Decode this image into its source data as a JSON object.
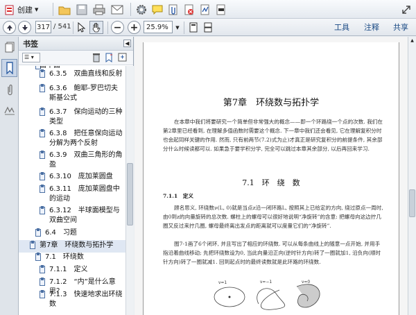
{
  "toolbar": {
    "create_label": "创建",
    "page_current": "317",
    "page_total": "/ 541",
    "zoom": "25.9%",
    "tab_tools": "工具",
    "tab_comment": "注释",
    "tab_share": "共享"
  },
  "bookmarks": {
    "title": "书签",
    "items": [
      {
        "label": "曲平面",
        "indent": 1
      },
      {
        "label": "6.3.5　双曲直线和反射",
        "indent": 2
      },
      {
        "label": "6.3.6　鲍耶-罗巴切夫斯基公式",
        "indent": 2
      },
      {
        "label": "6.3.7　保向运动的三种类型",
        "indent": 2
      },
      {
        "label": "6.3.8　把任意保向运动分解为两个反射",
        "indent": 2
      },
      {
        "label": "6.3.9　双曲三角形的角盈",
        "indent": 2
      },
      {
        "label": "6.3.10　庞加莱圆盘",
        "indent": 2
      },
      {
        "label": "6.3.11　庞加莱圆盘中的运动",
        "indent": 2
      },
      {
        "label": "6.3.12　半球面模型与双曲空间",
        "indent": 2
      },
      {
        "label": "6.4　习题",
        "indent": 1
      },
      {
        "label": "第7章　环绕数与拓扑学",
        "indent": 0,
        "selected": true
      },
      {
        "label": "7.1　环绕数",
        "indent": 1
      },
      {
        "label": "7.1.1　定义",
        "indent": 2
      },
      {
        "label": "7.1.2　“内”是什么意思？",
        "indent": 2
      },
      {
        "label": "7.1.3　快速地求出环绕数",
        "indent": 2
      }
    ]
  },
  "document": {
    "chapter_title": "第7章　环绕数与拓扑学",
    "intro": "在本章中我们将要研究一个简单但非常强大的概念——即一个环路绕一个点的次数. 我们在第2章里已经看到, 在理解多值函数时需要这个概念. 下一章中我们还会看见, 它在理解复积分时也会起同样关键的作用. 然而, 只有前两节(7.2)式为止)才真正是研究复积分的前提条件, 其余部分什么时候读都可以. 如果急于要学积分学, 完全可以跳过本章其余部分, 以后再回来学习.",
    "section_title": "7.1　环　绕　数",
    "subsection_title": "7.1.1　定义",
    "para1": "顾名思义, 环绕数ν(L, 0)就是当点z沿一闭环路L, 按照其上已给定的方向, 绕过原点一周时, 由0到z的向量旋转的总次数. 螺柱上的螺母可以很好地说明“净旋转”的含意: 把螺母向这边拧几圈又反过来拧几圈, 螺母最终离出发点的距离就可以度量它们的“净旋转”.",
    "para2": "图7-1画了6个闭环, 并且写出了相应的环绕数. 可以从每条曲线上的随意一点开始, 并用手指沿着曲线移动; 先把环绕数设为0, 当此向量沿正向(逆时针方向)转了一圈就加1, 沿负向(顺时针方向)转了一圈就减1. 回到起点时的最终读数就是此环路的环绕数.",
    "fig_labels": [
      "ν=1",
      "ν=−1",
      "ν=0"
    ]
  },
  "icons": [
    "create-icon",
    "open-icon",
    "save-icon",
    "print-icon",
    "email-icon",
    "gear-icon",
    "comment-icon",
    "attach-icon",
    "delete-icon",
    "sign-icon",
    "redact-icon",
    "expand-icon"
  ]
}
